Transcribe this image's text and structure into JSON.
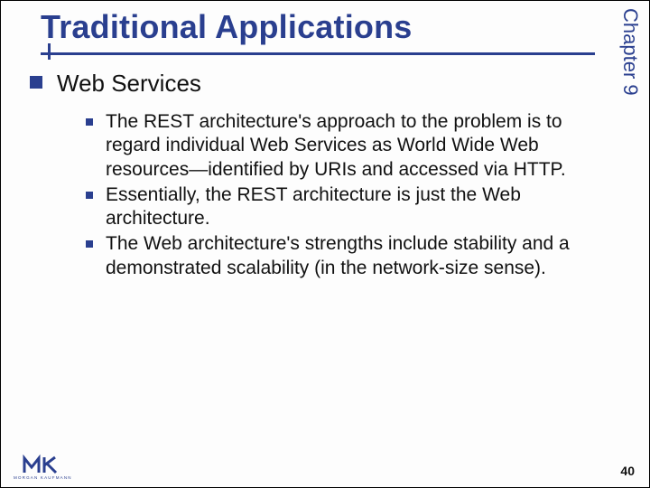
{
  "chapter_label": "Chapter 9",
  "title": "Traditional Applications",
  "lvl1": {
    "text": "Web Services"
  },
  "lvl2": [
    {
      "text": "The REST architecture's approach to the problem is to regard individual Web Services as World Wide Web resources—identified by URIs and accessed via HTTP."
    },
    {
      "text": "Essentially, the REST architecture is just the Web architecture."
    },
    {
      "text": "The Web architecture's strengths include stability and a demonstrated scalability (in the network-size sense)."
    }
  ],
  "publisher": "MORGAN KAUFMANN",
  "page_number": "40"
}
